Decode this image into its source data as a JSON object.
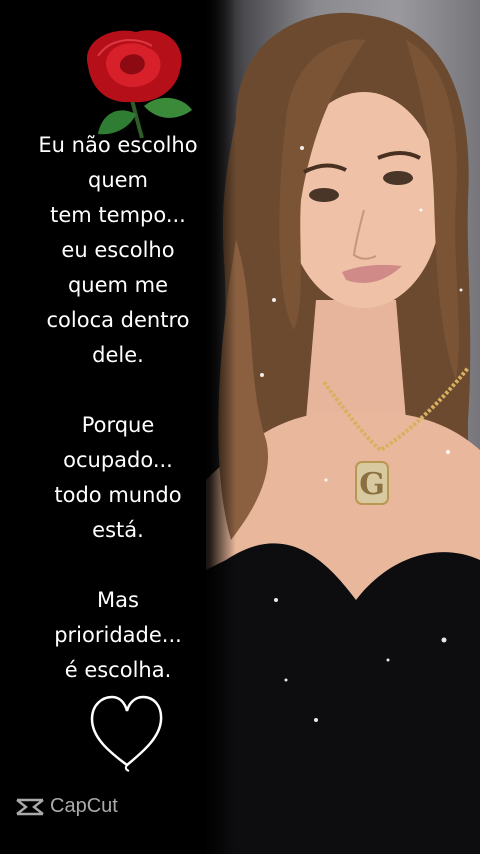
{
  "quote": {
    "stanza1": "Eu não escolho\nquem\ntem tempo...\neu escolho\nquem me\ncoloca dentro\ndele.",
    "stanza2": "Porque\nocupado...\ntodo mundo\nestá.",
    "stanza3": "Mas\nprioridade...\né escolha."
  },
  "pendant_letter": "G",
  "watermark": {
    "text": "CapCut",
    "icon": "capcut-logo-icon"
  },
  "colors": {
    "rose": "#c8101c",
    "leaf": "#2e7d32",
    "text": "#ffffff",
    "background": "#000000"
  }
}
